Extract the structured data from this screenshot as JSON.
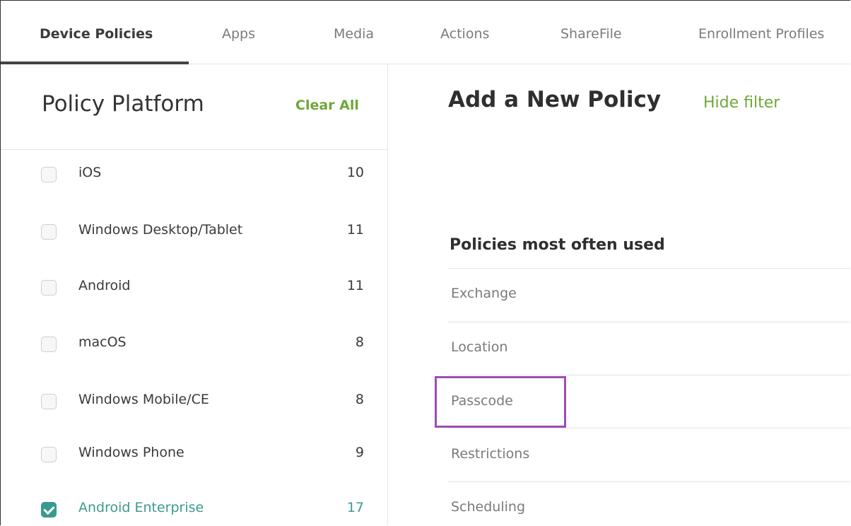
{
  "tabs": [
    {
      "label": "Device Policies",
      "active": true
    },
    {
      "label": "Apps",
      "active": false
    },
    {
      "label": "Media",
      "active": false
    },
    {
      "label": "Actions",
      "active": false
    },
    {
      "label": "ShareFile",
      "active": false
    },
    {
      "label": "Enrollment Profiles",
      "active": false
    }
  ],
  "sidebar": {
    "title": "Policy Platform",
    "clear_all_label": "Clear All",
    "platforms": [
      {
        "label": "iOS",
        "count": "10",
        "checked": false
      },
      {
        "label": "Windows Desktop/Tablet",
        "count": "11",
        "checked": false
      },
      {
        "label": "Android",
        "count": "11",
        "checked": false
      },
      {
        "label": "macOS",
        "count": "8",
        "checked": false
      },
      {
        "label": "Windows Mobile/CE",
        "count": "8",
        "checked": false
      },
      {
        "label": "Windows Phone",
        "count": "9",
        "checked": false
      },
      {
        "label": "Android Enterprise",
        "count": "17",
        "checked": true
      }
    ]
  },
  "main": {
    "title": "Add a New Policy",
    "hide_filter_label": "Hide filter",
    "section_heading": "Policies most often used",
    "policies": [
      "Exchange",
      "Location",
      "Passcode",
      "Restrictions",
      "Scheduling"
    ],
    "highlighted_policy": "Passcode"
  },
  "colors": {
    "accent_green": "#6ea837",
    "selected_teal": "#3b9a8f",
    "highlight_purple": "#9d4fb1"
  }
}
